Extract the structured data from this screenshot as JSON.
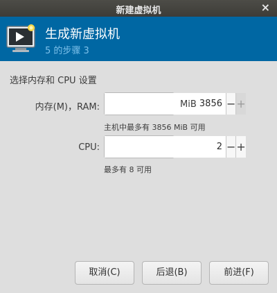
{
  "window": {
    "title": "新建虚拟机",
    "close_glyph": "×"
  },
  "header": {
    "title": "生成新虚拟机",
    "subtitle": "5 的步骤 3",
    "icon": "vm-screen-icon",
    "bg_color": "#0067a3"
  },
  "section_title": "选择内存和 CPU 设置",
  "memory": {
    "label": "内存(M)，RAM:",
    "value": "3856",
    "unit": "MiB",
    "hint": "主机中最多有 3856 MiB 可用",
    "minus": "−",
    "plus": "+"
  },
  "cpu": {
    "label": "CPU:",
    "value": "2",
    "hint": "最多有 8 可用",
    "minus": "−",
    "plus": "+"
  },
  "buttons": {
    "cancel": "取消(C)",
    "back": "后退(B)",
    "forward": "前进(F)"
  }
}
